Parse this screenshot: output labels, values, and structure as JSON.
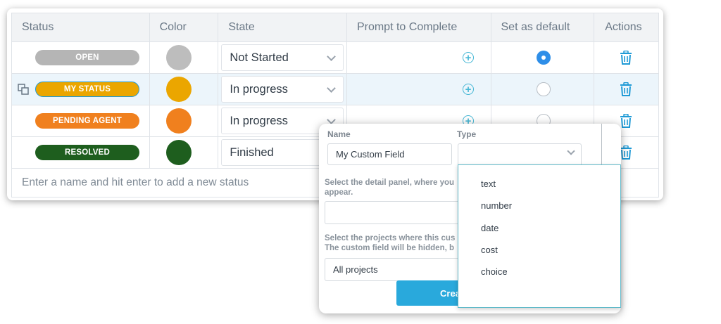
{
  "table": {
    "headers": [
      "Status",
      "Color",
      "State",
      "Prompt to Complete",
      "Set as default",
      "Actions"
    ],
    "rows": [
      {
        "status": "OPEN",
        "pill_color": "#b5b5b5",
        "swatch_color": "#bdbdbd",
        "state": "Not Started",
        "default": true
      },
      {
        "status": "MY STATUS",
        "pill_color": "#eba600",
        "swatch_color": "#eba600",
        "state": "In progress",
        "default": false
      },
      {
        "status": "PENDING AGENT",
        "pill_color": "#f0801e",
        "swatch_color": "#f0801e",
        "state": "In progress",
        "default": false
      },
      {
        "status": "RESOLVED",
        "pill_color": "#1e5e1e",
        "swatch_color": "#1e5e1e",
        "state": "Finished",
        "default": false
      }
    ],
    "add_placeholder": "Enter a name and hit enter to add a new status"
  },
  "custom_field": {
    "name_label": "Name",
    "name_value": "My Custom Field",
    "type_label": "Type",
    "type_value": "",
    "panel_desc_line1": "Select the detail panel, where you",
    "panel_desc_line2": "appear.",
    "projects_desc_line1": "Select the projects where this cus",
    "projects_desc_line2": "The custom field will be hidden, b",
    "projects_value": "All projects",
    "create_label": "Crea",
    "type_options": [
      "text",
      "number",
      "date",
      "cost",
      "choice"
    ]
  },
  "colors": {
    "accent": "#29a9dc",
    "radio_on": "#2e8ee8",
    "icon_teal": "#45b7d5"
  }
}
